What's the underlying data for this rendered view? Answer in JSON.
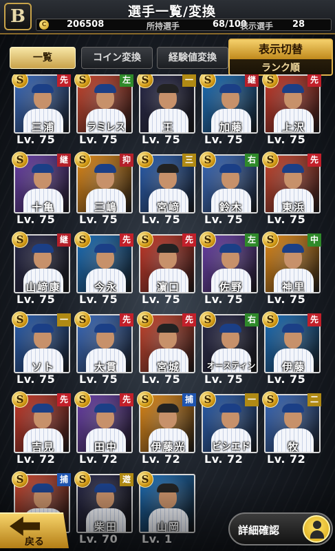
{
  "header": {
    "title": "選手一覧/変換",
    "team_logo": "B",
    "coins": "206508",
    "owned_label": "所持選手",
    "owned_value": "68/100",
    "shown_label": "表示選手",
    "shown_value": "28"
  },
  "tabs": [
    {
      "label": "一覧",
      "active": true
    },
    {
      "label": "コイン変換",
      "active": false
    },
    {
      "label": "経験値変換",
      "active": false
    }
  ],
  "display_toggle": {
    "title": "表示切替",
    "sort": "ランク順"
  },
  "players": [
    {
      "name": "三浦",
      "pos": "先",
      "level": "Lv. 75",
      "rank": "S"
    },
    {
      "name": "ラミレス",
      "pos": "左",
      "level": "Lv. 75",
      "rank": "S"
    },
    {
      "name": "王",
      "pos": "一",
      "level": "Lv. 75",
      "rank": "S"
    },
    {
      "name": "加藤",
      "pos": "継",
      "level": "Lv. 75",
      "rank": "S"
    },
    {
      "name": "上沢",
      "pos": "先",
      "level": "Lv. 75",
      "rank": "S"
    },
    {
      "name": "十亀",
      "pos": "継",
      "level": "Lv. 75",
      "rank": "S"
    },
    {
      "name": "三嶋",
      "pos": "抑",
      "level": "Lv. 75",
      "rank": "S"
    },
    {
      "name": "宮﨑",
      "pos": "三",
      "level": "Lv. 75",
      "rank": "S"
    },
    {
      "name": "鈴木",
      "pos": "右",
      "level": "Lv. 75",
      "rank": "S"
    },
    {
      "name": "東浜",
      "pos": "先",
      "level": "Lv. 75",
      "rank": "S"
    },
    {
      "name": "山﨑康",
      "pos": "継",
      "level": "Lv. 75",
      "rank": "S"
    },
    {
      "name": "今永",
      "pos": "先",
      "level": "Lv. 75",
      "rank": "S"
    },
    {
      "name": "濵口",
      "pos": "先",
      "level": "Lv. 75",
      "rank": "S"
    },
    {
      "name": "佐野",
      "pos": "左",
      "level": "Lv. 75",
      "rank": "S"
    },
    {
      "name": "神里",
      "pos": "中",
      "level": "Lv. 75",
      "rank": "S"
    },
    {
      "name": "ソト",
      "pos": "一",
      "level": "Lv. 75",
      "rank": "S"
    },
    {
      "name": "大貫",
      "pos": "先",
      "level": "Lv. 75",
      "rank": "S"
    },
    {
      "name": "宮城",
      "pos": "先",
      "level": "Lv. 75",
      "rank": "S"
    },
    {
      "name": "オースティン",
      "pos": "右",
      "level": "Lv. 75",
      "rank": "S"
    },
    {
      "name": "伊藤",
      "pos": "先",
      "level": "Lv. 75",
      "rank": "S"
    },
    {
      "name": "吉見",
      "pos": "先",
      "level": "Lv. 72",
      "rank": "S"
    },
    {
      "name": "田中",
      "pos": "先",
      "level": "Lv. 72",
      "rank": "S"
    },
    {
      "name": "伊藤光",
      "pos": "捕",
      "level": "Lv. 72",
      "rank": "S"
    },
    {
      "name": "ビシエド",
      "pos": "一",
      "level": "Lv. 72",
      "rank": "S"
    },
    {
      "name": "牧",
      "pos": "二",
      "level": "Lv. 72",
      "rank": "S"
    },
    {
      "name": "",
      "pos": "捕",
      "level": "",
      "rank": "S"
    },
    {
      "name": "柴田",
      "pos": "遊",
      "level": "Lv. 70",
      "rank": "S"
    },
    {
      "name": "山岡",
      "pos": "",
      "level": "Lv. 1",
      "rank": "S"
    }
  ],
  "card_backgrounds": [
    "#3b6bbd",
    "#c8462f",
    "#2a2a4a",
    "#1d6fb8",
    "#c73a2a",
    "#6a40a8",
    "#e08a1a",
    "#2b5fb0"
  ],
  "position_colors": {
    "先": "#c2202a",
    "継": "#b4202a",
    "抑": "#b4202a",
    "左": "#2f8a2a",
    "右": "#2f8a2a",
    "中": "#2f8a2a",
    "一": "#b08a14",
    "二": "#b08a14",
    "三": "#b08a14",
    "遊": "#b08a14",
    "捕": "#1f55b0"
  },
  "buttons": {
    "back": "戻る",
    "detail": "詳細確認"
  }
}
